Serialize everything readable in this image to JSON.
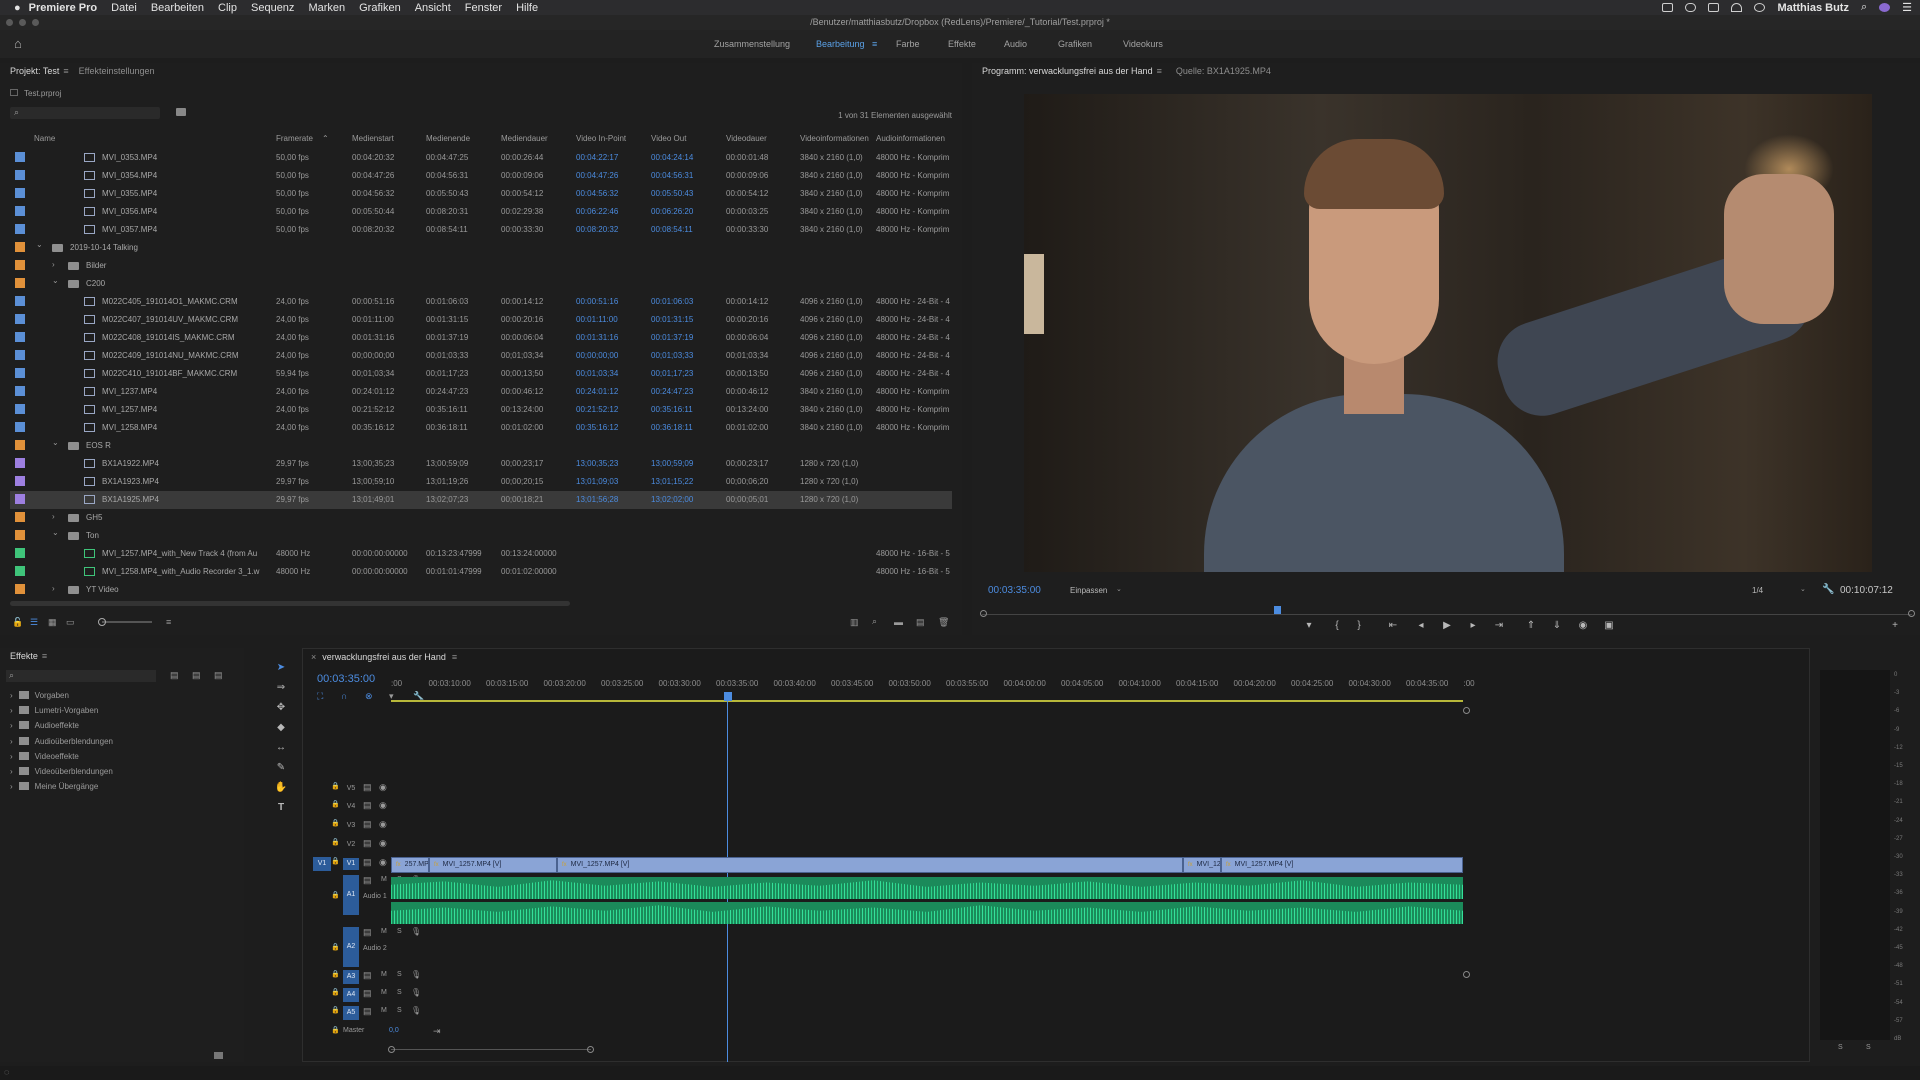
{
  "menubar": {
    "apple": "",
    "app_name": "Premiere Pro",
    "items": [
      "Datei",
      "Bearbeiten",
      "Clip",
      "Sequenz",
      "Marken",
      "Grafiken",
      "Ansicht",
      "Fenster",
      "Hilfe"
    ],
    "user": "Matthias Butz"
  },
  "titlebar": {
    "path": "/Benutzer/matthiasbutz/Dropbox (RedLens)/Premiere/_Tutorial/Test.prproj *"
  },
  "workspaces": {
    "items": [
      "Zusammenstellung",
      "Bearbeitung",
      "Farbe",
      "Effekte",
      "Audio",
      "Grafiken",
      "Videokurs"
    ],
    "active": "Bearbeitung"
  },
  "project": {
    "tab_project": "Projekt: Test",
    "tab_effect_settings": "Effekteinstellungen",
    "file": "Test.prproj",
    "search_placeholder": "",
    "selection_info": "1 von 31 Elementen ausgewählt",
    "columns": [
      "Name",
      "Framerate",
      "Medienstart",
      "Medienende",
      "Mediendauer",
      "Video In-Point",
      "Video Out",
      "Videodauer",
      "Videoinformationen",
      "Audioinformationen"
    ],
    "rows": [
      {
        "indent": 3,
        "type": "clip",
        "color": "#5b8fd6",
        "name": "MVI_0353.MP4",
        "fps": "50,00 fps",
        "start": "00:04:20:32",
        "end": "00:04:47:25",
        "dur": "00:00:26:44",
        "in": "00:04:22:17",
        "out": "00:04:24:14",
        "vdur": "00:00:01:48",
        "vinfo": "3840 x 2160 (1,0)",
        "ainfo": "48000 Hz - Komprim"
      },
      {
        "indent": 3,
        "type": "clip",
        "color": "#5b8fd6",
        "name": "MVI_0354.MP4",
        "fps": "50,00 fps",
        "start": "00:04:47:26",
        "end": "00:04:56:31",
        "dur": "00:00:09:06",
        "in": "00:04:47:26",
        "out": "00:04:56:31",
        "vdur": "00:00:09:06",
        "vinfo": "3840 x 2160 (1,0)",
        "ainfo": "48000 Hz - Komprim"
      },
      {
        "indent": 3,
        "type": "clip",
        "color": "#5b8fd6",
        "name": "MVI_0355.MP4",
        "fps": "50,00 fps",
        "start": "00:04:56:32",
        "end": "00:05:50:43",
        "dur": "00:00:54:12",
        "in": "00:04:56:32",
        "out": "00:05:50:43",
        "vdur": "00:00:54:12",
        "vinfo": "3840 x 2160 (1,0)",
        "ainfo": "48000 Hz - Komprim"
      },
      {
        "indent": 3,
        "type": "clip",
        "color": "#5b8fd6",
        "name": "MVI_0356.MP4",
        "fps": "50,00 fps",
        "start": "00:05:50:44",
        "end": "00:08:20:31",
        "dur": "00:02:29:38",
        "in": "00:06:22:46",
        "out": "00:06:26:20",
        "vdur": "00:00:03:25",
        "vinfo": "3840 x 2160 (1,0)",
        "ainfo": "48000 Hz - Komprim"
      },
      {
        "indent": 3,
        "type": "clip",
        "color": "#5b8fd6",
        "name": "MVI_0357.MP4",
        "fps": "50,00 fps",
        "start": "00:08:20:32",
        "end": "00:08:54:11",
        "dur": "00:00:33:30",
        "in": "00:08:20:32",
        "out": "00:08:54:11",
        "vdur": "00:00:33:30",
        "vinfo": "3840 x 2160 (1,0)",
        "ainfo": "48000 Hz - Komprim"
      },
      {
        "indent": 1,
        "type": "bin",
        "open": true,
        "color": "#e0913a",
        "name": "2019-10-14 Talking"
      },
      {
        "indent": 2,
        "type": "bin",
        "open": false,
        "color": "#e0913a",
        "name": "Bilder"
      },
      {
        "indent": 2,
        "type": "bin",
        "open": true,
        "color": "#e0913a",
        "name": "C200"
      },
      {
        "indent": 3,
        "type": "clip",
        "color": "#5b8fd6",
        "name": "M022C405_191014O1_MAKMC.CRM",
        "fps": "24,00 fps",
        "start": "00:00:51:16",
        "end": "00:01:06:03",
        "dur": "00:00:14:12",
        "in": "00:00:51:16",
        "out": "00:01:06:03",
        "vdur": "00:00:14:12",
        "vinfo": "4096 x 2160 (1,0)",
        "ainfo": "48000 Hz - 24-Bit - 4"
      },
      {
        "indent": 3,
        "type": "clip",
        "color": "#5b8fd6",
        "name": "M022C407_191014UV_MAKMC.CRM",
        "fps": "24,00 fps",
        "start": "00:01:11:00",
        "end": "00:01:31:15",
        "dur": "00:00:20:16",
        "in": "00:01:11:00",
        "out": "00:01:31:15",
        "vdur": "00:00:20:16",
        "vinfo": "4096 x 2160 (1,0)",
        "ainfo": "48000 Hz - 24-Bit - 4"
      },
      {
        "indent": 3,
        "type": "clip",
        "color": "#5b8fd6",
        "name": "M022C408_191014IS_MAKMC.CRM",
        "fps": "24,00 fps",
        "start": "00:01:31:16",
        "end": "00:01:37:19",
        "dur": "00:00:06:04",
        "in": "00:01:31:16",
        "out": "00:01:37:19",
        "vdur": "00:00:06:04",
        "vinfo": "4096 x 2160 (1,0)",
        "ainfo": "48000 Hz - 24-Bit - 4"
      },
      {
        "indent": 3,
        "type": "clip",
        "color": "#5b8fd6",
        "name": "M022C409_191014NU_MAKMC.CRM",
        "fps": "24,00 fps",
        "start": "00;00;00;00",
        "end": "00;01;03;33",
        "dur": "00;01;03;34",
        "in": "00;00;00;00",
        "out": "00;01;03;33",
        "vdur": "00;01;03;34",
        "vinfo": "4096 x 2160 (1,0)",
        "ainfo": "48000 Hz - 24-Bit - 4"
      },
      {
        "indent": 3,
        "type": "clip",
        "color": "#5b8fd6",
        "name": "M022C410_191014BF_MAKMC.CRM",
        "fps": "59,94 fps",
        "start": "00;01;03;34",
        "end": "00;01;17;23",
        "dur": "00;00;13;50",
        "in": "00;01;03;34",
        "out": "00;01;17;23",
        "vdur": "00;00;13;50",
        "vinfo": "4096 x 2160 (1,0)",
        "ainfo": "48000 Hz - 24-Bit - 4"
      },
      {
        "indent": 3,
        "type": "clip",
        "color": "#5b8fd6",
        "name": "MVI_1237.MP4",
        "fps": "24,00 fps",
        "start": "00:24:01:12",
        "end": "00:24:47:23",
        "dur": "00:00:46:12",
        "in": "00:24:01:12",
        "out": "00:24:47:23",
        "vdur": "00:00:46:12",
        "vinfo": "3840 x 2160 (1,0)",
        "ainfo": "48000 Hz - Komprim"
      },
      {
        "indent": 3,
        "type": "clip",
        "color": "#5b8fd6",
        "name": "MVI_1257.MP4",
        "fps": "24,00 fps",
        "start": "00:21:52:12",
        "end": "00:35:16:11",
        "dur": "00:13:24:00",
        "in": "00:21:52:12",
        "out": "00:35:16:11",
        "vdur": "00:13:24:00",
        "vinfo": "3840 x 2160 (1,0)",
        "ainfo": "48000 Hz - Komprim"
      },
      {
        "indent": 3,
        "type": "clip",
        "color": "#5b8fd6",
        "name": "MVI_1258.MP4",
        "fps": "24,00 fps",
        "start": "00:35:16:12",
        "end": "00:36:18:11",
        "dur": "00:01:02:00",
        "in": "00:35:16:12",
        "out": "00:36:18:11",
        "vdur": "00:01:02:00",
        "vinfo": "3840 x 2160 (1,0)",
        "ainfo": "48000 Hz - Komprim"
      },
      {
        "indent": 2,
        "type": "bin",
        "open": true,
        "color": "#e0913a",
        "name": "EOS R"
      },
      {
        "indent": 3,
        "type": "clip",
        "color": "#9d7fe0",
        "name": "BX1A1922.MP4",
        "fps": "29,97 fps",
        "start": "13;00;35;23",
        "end": "13;00;59;09",
        "dur": "00;00;23;17",
        "in": "13;00;35;23",
        "out": "13;00;59;09",
        "vdur": "00;00;23;17",
        "vinfo": "1280 x 720 (1,0)",
        "ainfo": ""
      },
      {
        "indent": 3,
        "type": "clip",
        "color": "#9d7fe0",
        "name": "BX1A1923.MP4",
        "fps": "29,97 fps",
        "start": "13;00;59;10",
        "end": "13;01;19;26",
        "dur": "00;00;20;15",
        "in": "13;01;09;03",
        "out": "13;01;15;22",
        "vdur": "00;00;06;20",
        "vinfo": "1280 x 720 (1,0)",
        "ainfo": ""
      },
      {
        "indent": 3,
        "type": "clip",
        "color": "#9d7fe0",
        "name": "BX1A1925.MP4",
        "fps": "29,97 fps",
        "start": "13;01;49;01",
        "end": "13;02;07;23",
        "dur": "00;00;18;21",
        "in": "13;01;56;28",
        "out": "13;02;02;00",
        "vdur": "00;00;05;01",
        "vinfo": "1280 x 720 (1,0)",
        "ainfo": "",
        "selected": true
      },
      {
        "indent": 2,
        "type": "bin",
        "open": false,
        "color": "#e0913a",
        "name": "GH5"
      },
      {
        "indent": 2,
        "type": "bin",
        "open": true,
        "color": "#e0913a",
        "name": "Ton"
      },
      {
        "indent": 3,
        "type": "audio",
        "color": "#3fc47a",
        "name": "MVI_1257.MP4_with_New Track 4 (from Au",
        "fps": "48000  Hz",
        "start": "00:00:00:00000",
        "end": "00:13:23:47999",
        "dur": "00:13:24:00000",
        "in": "",
        "out": "",
        "vdur": "",
        "vinfo": "",
        "ainfo": "48000 Hz - 16-Bit - 5"
      },
      {
        "indent": 3,
        "type": "audio",
        "color": "#3fc47a",
        "name": "MVI_1258.MP4_with_Audio Recorder 3_1.w",
        "fps": "48000  Hz",
        "start": "00:00:00:00000",
        "end": "00:01:01:47999",
        "dur": "00:01:02:00000",
        "in": "",
        "out": "",
        "vdur": "",
        "vinfo": "",
        "ainfo": "48000 Hz - 16-Bit - 5"
      },
      {
        "indent": 2,
        "type": "bin",
        "open": false,
        "color": "#e0913a",
        "name": "YT Video"
      }
    ]
  },
  "monitor": {
    "tab_program": "Programm: verwacklungsfrei aus der Hand",
    "tab_source": "Quelle: BX1A1925.MP4",
    "timecode": "00:03:35:00",
    "fit": "Einpassen",
    "resolution": "1/4",
    "duration": "00:10:07:12"
  },
  "effects": {
    "tab": "Effekte",
    "items": [
      "Vorgaben",
      "Lumetri-Vorgaben",
      "Audioeffekte",
      "Audioüberblendungen",
      "Videoeffekte",
      "Videoüberblendungen",
      "Meine Übergänge"
    ]
  },
  "timeline": {
    "sequence_tab": "verwacklungsfrei aus der Hand",
    "timecode": "00:03:35:00",
    "ruler": [
      ":00",
      "00:03:10:00",
      "00:03:15:00",
      "00:03:20:00",
      "00:03:25:00",
      "00:03:30:00",
      "00:03:35:00",
      "00:03:40:00",
      "00:03:45:00",
      "00:03:50:00",
      "00:03:55:00",
      "00:04:00:00",
      "00:04:05:00",
      "00:04:10:00",
      "00:04:15:00",
      "00:04:20:00",
      "00:04:25:00",
      "00:04:30:00",
      "00:04:35:00",
      ":00"
    ],
    "video_tracks": [
      "V5",
      "V4",
      "V3",
      "V2",
      "V1"
    ],
    "source_patch": "V1",
    "audio_tracks": [
      {
        "patch": "A1",
        "name": "Audio 1"
      },
      {
        "patch": "A2",
        "name": "Audio 2"
      },
      {
        "patch": "A3",
        "name": ""
      },
      {
        "patch": "A4",
        "name": ""
      },
      {
        "patch": "A5",
        "name": ""
      }
    ],
    "mute": "M",
    "solo": "S",
    "master_label": "Master",
    "master_value": "0,0",
    "clips_v1": [
      "257.MP4 [V]",
      "MVI_1257.MP4 [V]",
      "MVI_1257.MP4 [V]",
      "MVI_12",
      "MVI_1257.MP4 [V]"
    ]
  },
  "meters": {
    "scale": [
      "0",
      "-3",
      "-6",
      "-9",
      "-12",
      "-15",
      "-18",
      "-21",
      "-24",
      "-27",
      "-30",
      "-33",
      "-36",
      "-39",
      "-42",
      "-45",
      "-48",
      "-51",
      "-54",
      "-57",
      "dB"
    ],
    "solo_left": "S",
    "solo_right": "S"
  },
  "colors": {
    "accent_blue": "#4c8ce0",
    "clip_video": "#8aa4d6",
    "clip_audio": "#1b8a5a",
    "label_orange": "#e0913a",
    "label_violet": "#9d7fe0",
    "label_green": "#3fc47a"
  },
  "icons": {
    "home": "home-icon",
    "search": "search-icon",
    "wrench": "wrench-icon",
    "lock": "lock-icon",
    "eye": "eye-icon",
    "microphone": "microphone-icon",
    "play": "play-icon",
    "camera": "camera-icon"
  }
}
